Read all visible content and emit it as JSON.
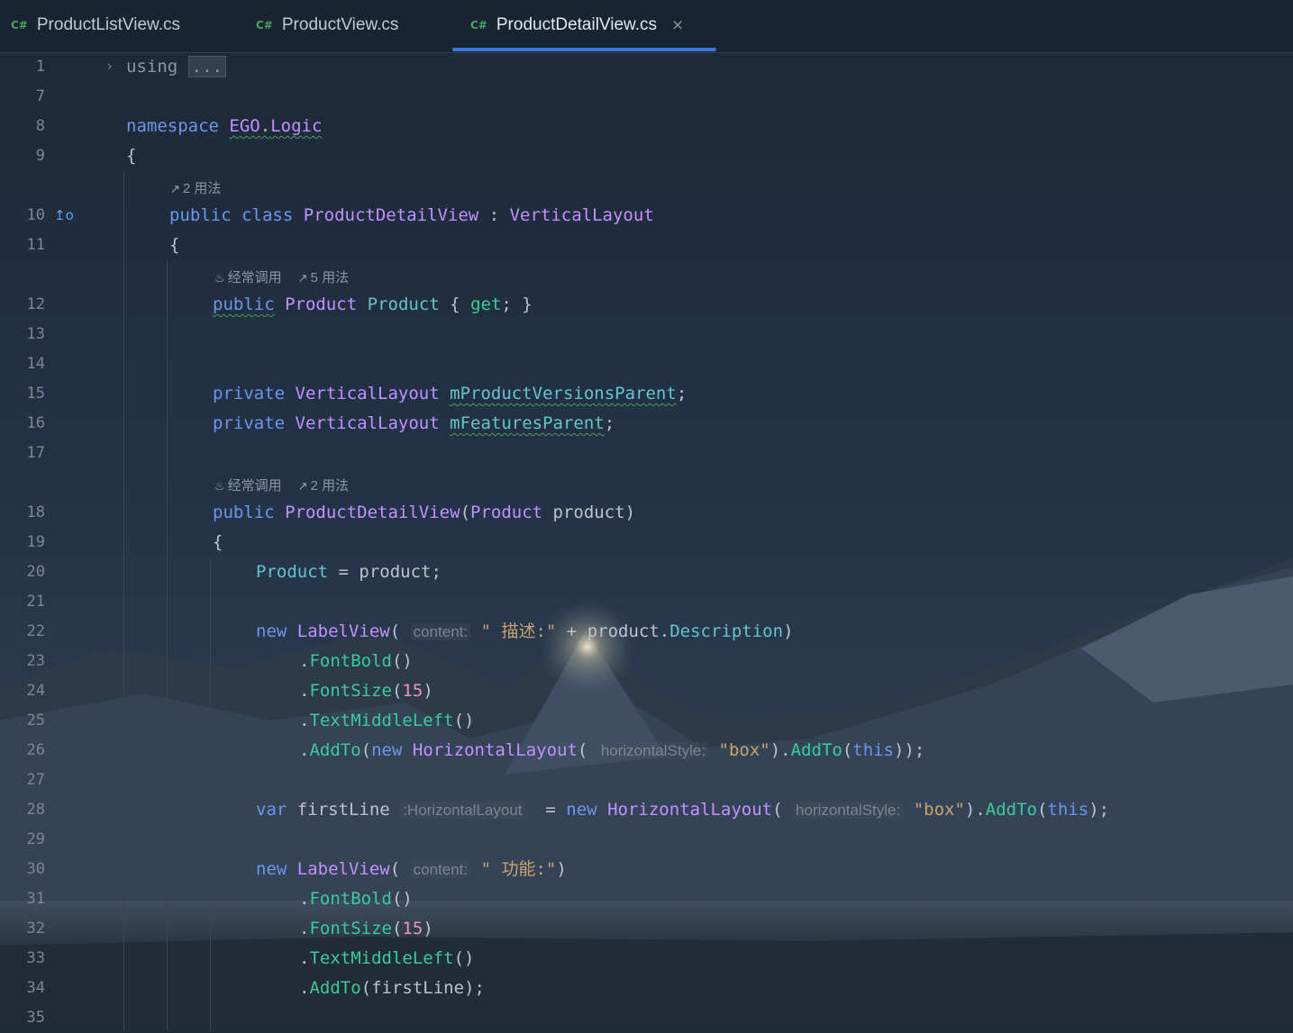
{
  "tabs": [
    {
      "badge": "C#",
      "name": "ProductListView.cs",
      "active": false
    },
    {
      "badge": "C#",
      "name": "ProductView.cs",
      "active": false
    },
    {
      "badge": "C#",
      "name": "ProductDetailView.cs",
      "active": true,
      "close": "×"
    }
  ],
  "colors": {
    "keyword": "#6c95eb",
    "type": "#c191ff",
    "property": "#66c3cc",
    "method": "#39cc9b",
    "string": "#c9a26d",
    "number": "#ed94c0",
    "tab_accent": "#3d78d6"
  },
  "gutter": {
    "implementation_icon": "implementation-icon",
    "fold_icon": "chevron-right-icon"
  },
  "hints": {
    "usages_2": "2 用法",
    "usages_5": "5 用法",
    "frequent": "经常调用",
    "usage_icon": "link-arrow-icon",
    "frequent_icon": "flame-icon"
  },
  "code": {
    "l1_kw": "using",
    "l1_fold": "...",
    "l8_kw": "namespace",
    "l8_ns1": "EGO",
    "l8_dot": ".",
    "l8_ns2": "Logic",
    "brace_open": "{",
    "brace_close": "}",
    "l10_public": "public",
    "l10_class": "class",
    "l10_name": "ProductDetailView",
    "l10_colon": ":",
    "l10_base": "VerticalLayout",
    "l12_public": "public",
    "l12_type": "Product",
    "l12_name": "Product",
    "l12_get": "get",
    "l12_semi": ";",
    "private": "private",
    "vlayout": "VerticalLayout",
    "l15_field": "mProductVersionsParent",
    "l16_field": "mFeaturesParent",
    "semi": ";",
    "l18_public": "public",
    "l18_name": "ProductDetailView",
    "l18_open": "(",
    "l18_ptype": "Product",
    "l18_pname": "product",
    "l18_close": ")",
    "l20_prop": "Product",
    "l20_eq": " = ",
    "l20_val": "product",
    "new": "new",
    "labelview": "LabelView",
    "paren_open": "(",
    "paren_close": ")",
    "hint_content": "content:",
    "l22_str": "\" 描述:\"",
    "l22_plus": " + ",
    "l22_obj": "product",
    "l22_dot": ".",
    "l22_prop": "Description",
    "dot": ".",
    "fontbold": "FontBold",
    "fontsize": "FontSize",
    "num15": "15",
    "textmiddleleft": "TextMiddleLeft",
    "addto": "AddTo",
    "unit_parens": "()",
    "horizontallayout": "HorizontalLayout",
    "hint_hstyle": "horizontalStyle:",
    "str_box": "\"box\"",
    "this": "this",
    "l26_end": "));",
    "l28_var": "var",
    "l28_name": "firstLine",
    "l28_hint": ":HorizontalLayout",
    "l28_eq": " = ",
    "l28_end": ");",
    "l30_str": "\" 功能:\"",
    "l34_arg": "firstLine",
    "l34_end": ");"
  },
  "line_numbers": [
    "1",
    "7",
    "8",
    "9",
    "10",
    "11",
    "12",
    "13",
    "14",
    "15",
    "16",
    "17",
    "18",
    "19",
    "20",
    "21",
    "22",
    "23",
    "24",
    "25",
    "26",
    "27",
    "28",
    "29",
    "30",
    "31",
    "32",
    "33",
    "34",
    "35"
  ]
}
